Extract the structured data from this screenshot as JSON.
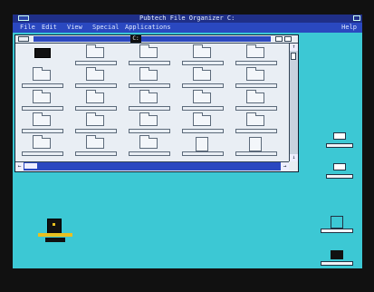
{
  "app": {
    "title": "Pubtech File Organizer  C:"
  },
  "menu": {
    "items": [
      "File",
      "Edit",
      "View",
      "Special",
      "Applications"
    ],
    "help": "Help"
  },
  "window": {
    "path": "C:",
    "scroll_up": "↑",
    "scroll_down": "↓",
    "scroll_left": "←",
    "scroll_right": "→"
  },
  "files": [
    {
      "label": "",
      "type": "drive"
    },
    {
      "label": "",
      "type": "folder"
    },
    {
      "label": "",
      "type": "folder"
    },
    {
      "label": "",
      "type": "folder"
    },
    {
      "label": "",
      "type": "folder"
    },
    {
      "label": "",
      "type": "folder"
    },
    {
      "label": "",
      "type": "folder"
    },
    {
      "label": "",
      "type": "folder"
    },
    {
      "label": "",
      "type": "folder"
    },
    {
      "label": "",
      "type": "folder"
    },
    {
      "label": "",
      "type": "folder"
    },
    {
      "label": "",
      "type": "folder"
    },
    {
      "label": "",
      "type": "folder"
    },
    {
      "label": "",
      "type": "folder"
    },
    {
      "label": "",
      "type": "folder"
    },
    {
      "label": "",
      "type": "folder"
    },
    {
      "label": "",
      "type": "folder"
    },
    {
      "label": "",
      "type": "folder"
    },
    {
      "label": "",
      "type": "folder"
    },
    {
      "label": "",
      "type": "folder"
    },
    {
      "label": "",
      "type": "folder"
    },
    {
      "label": "",
      "type": "folder"
    },
    {
      "label": "",
      "type": "folder"
    },
    {
      "label": "",
      "type": "doc"
    },
    {
      "label": "",
      "type": "doc"
    }
  ],
  "desktop": {
    "right_icons": [
      "",
      "",
      "",
      ""
    ],
    "program": ""
  },
  "colors": {
    "desktop": "#3cc8d4",
    "titlebar": "#1f2f88",
    "menubar": "#2a48c0",
    "accent": "#e8c020"
  }
}
